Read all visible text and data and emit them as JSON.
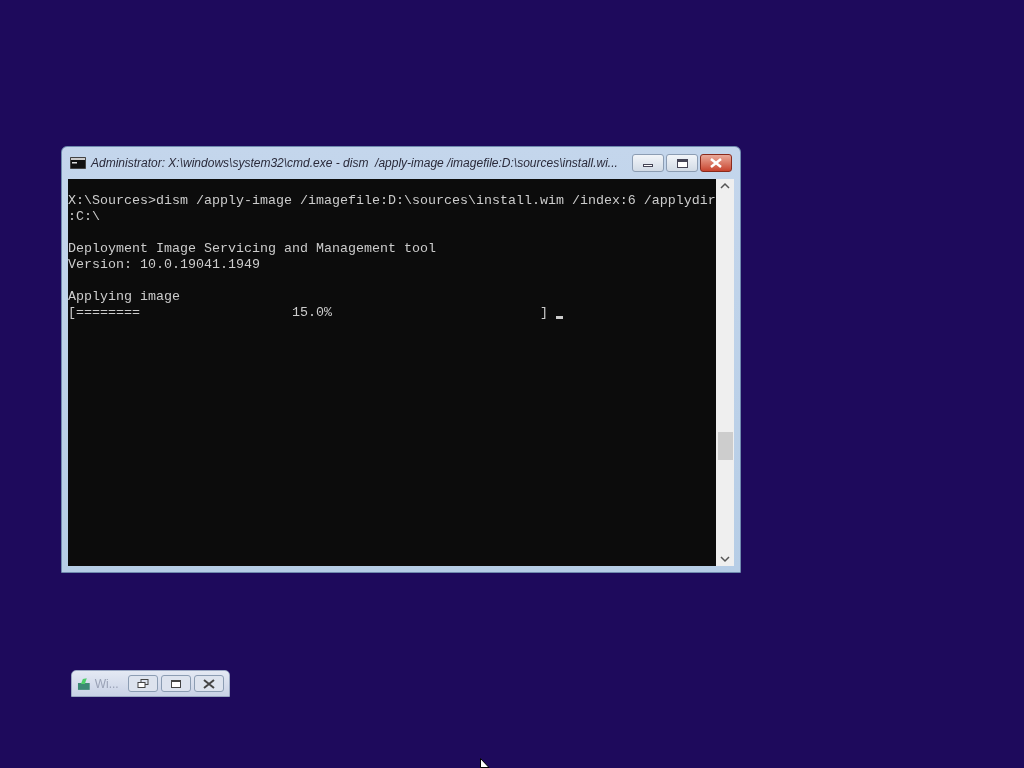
{
  "console_window": {
    "title": "Administrator: X:\\windows\\system32\\cmd.exe - dism  /apply-image /imagefile:D:\\sources\\install.wi...",
    "blocks": [
      [
        "X:\\Sources>dism /apply-image /imagefile:D:\\sources\\install.wim /index:6 /applydir",
        ":C:\\"
      ],
      [
        "Deployment Image Servicing and Management tool",
        "Version: 10.0.19041.1949"
      ],
      [
        "Applying image",
        "[========                   15.0%                          ]"
      ]
    ]
  },
  "minimized_window": {
    "title": "Wi..."
  }
}
